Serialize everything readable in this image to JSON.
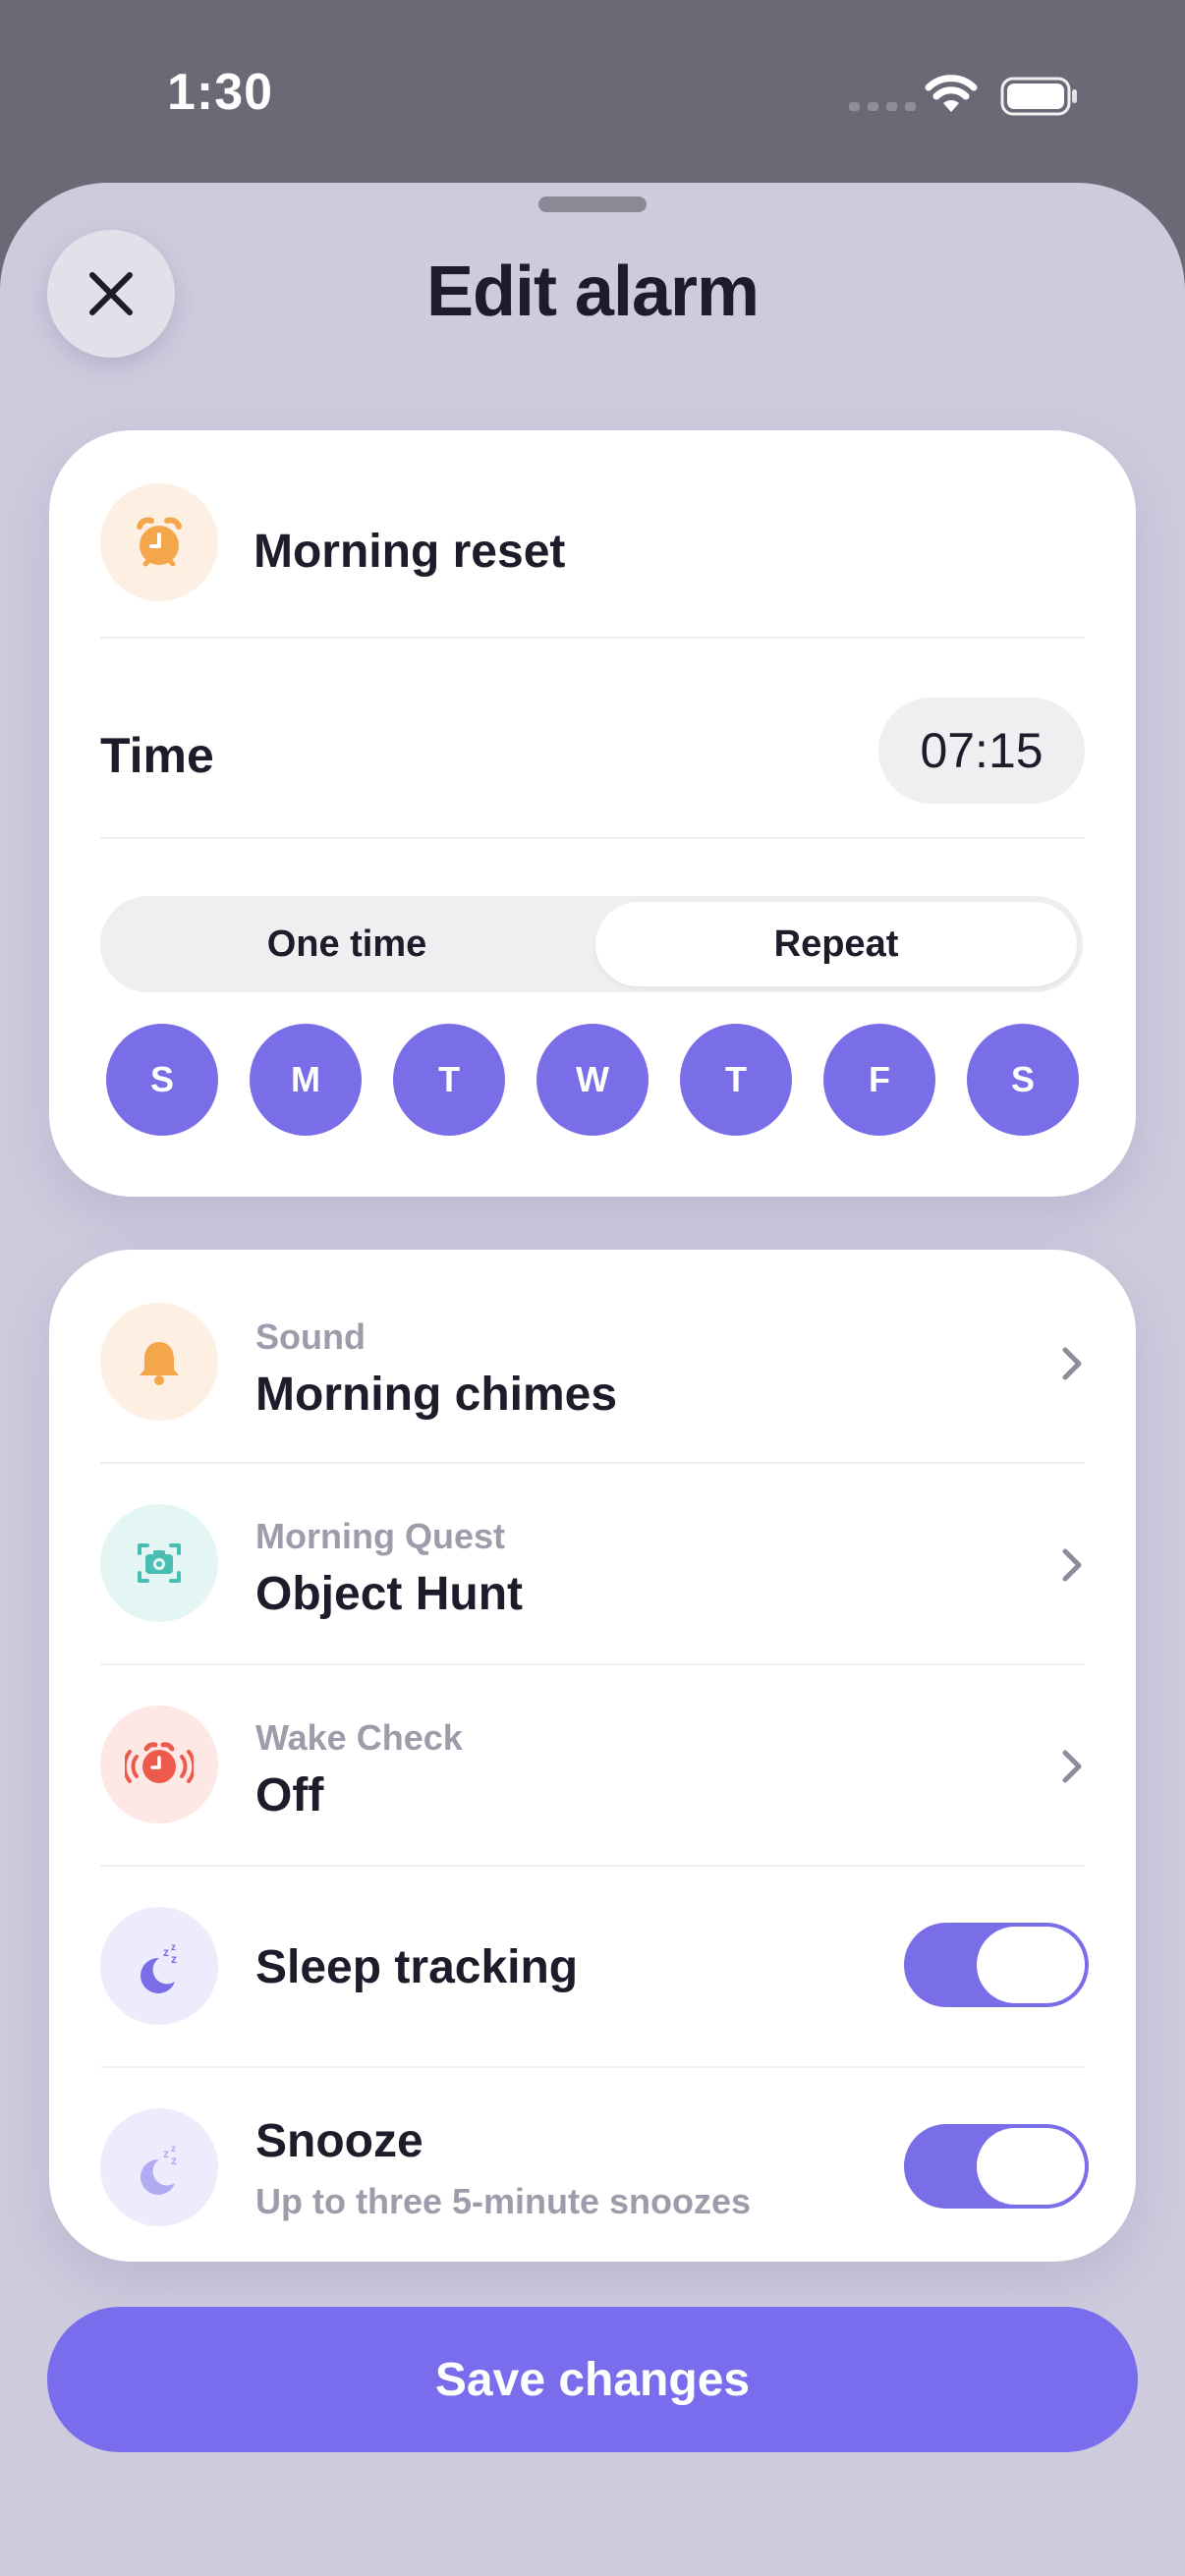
{
  "status_bar": {
    "time": "1:30"
  },
  "header": {
    "title": "Edit alarm",
    "close_icon": "close-icon"
  },
  "alarm": {
    "name": "Morning reset",
    "icon": "alarm-clock-icon",
    "time_label": "Time",
    "time_value": "07:15",
    "frequency": {
      "options": [
        "One time",
        "Repeat"
      ],
      "selected": "Repeat"
    },
    "days": [
      "S",
      "M",
      "T",
      "W",
      "T",
      "F",
      "S"
    ],
    "days_selected": [
      true,
      true,
      true,
      true,
      true,
      true,
      true
    ]
  },
  "settings": {
    "sound": {
      "caption": "Sound",
      "value": "Morning chimes",
      "icon": "bell-icon"
    },
    "quest": {
      "caption": "Morning Quest",
      "value": "Object Hunt",
      "icon": "camera-scan-icon"
    },
    "wake_check": {
      "caption": "Wake Check",
      "value": "Off",
      "icon": "ringing-alarm-icon"
    },
    "sleep_tracking": {
      "label": "Sleep tracking",
      "enabled": true,
      "icon": "moon-sleep-icon"
    },
    "snooze": {
      "label": "Snooze",
      "subtitle": "Up to three 5-minute snoozes",
      "enabled": true,
      "icon": "moon-sleep-icon"
    }
  },
  "footer": {
    "save_label": "Save changes"
  },
  "colors": {
    "accent": "#7a6de8",
    "sheet_background": "#cecbde",
    "orange_icon": "#f4a64a",
    "teal_icon": "#49bfb3",
    "red_icon": "#ec5a4b"
  }
}
